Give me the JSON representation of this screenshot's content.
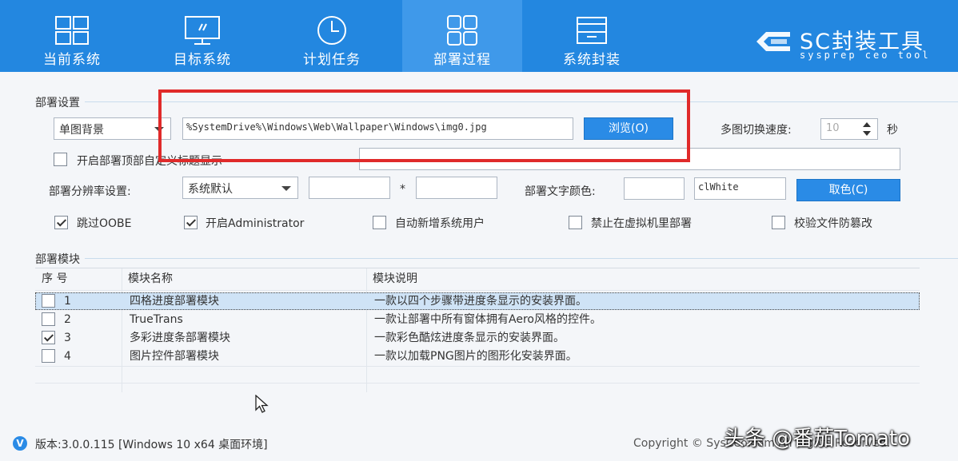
{
  "nav": {
    "tabs": [
      {
        "label": "当前系统",
        "icon": "windows-grid-icon"
      },
      {
        "label": "目标系统",
        "icon": "monitor-icon"
      },
      {
        "label": "计划任务",
        "icon": "clock-icon"
      },
      {
        "label": "部署过程",
        "icon": "blocks-icon",
        "active": true
      },
      {
        "label": "系统封装",
        "icon": "package-icon"
      }
    ],
    "brand_title": "SC封装工具",
    "brand_sub": "sysprep ceo tool"
  },
  "deploy_settings": {
    "title": "部署设置",
    "background_mode": "单图背景",
    "wallpaper_path": "%SystemDrive%\\Windows\\Web\\Wallpaper\\Windows\\img0.jpg",
    "browse_label": "浏览(O)",
    "switch_speed_label": "多图切换速度:",
    "switch_speed_value": "10",
    "seconds_label": "秒",
    "custom_title_checkbox_label": "开启部署顶部自定义标题显示",
    "custom_title_input_value": "",
    "resolution_label": "部署分辨率设置:",
    "resolution_mode": "系统默认",
    "resolution_width": "",
    "resolution_times": "*",
    "resolution_height": "",
    "text_color_label": "部署文字颜色:",
    "text_color_hex": "",
    "text_color_name": "clWhite",
    "pick_color_label": "取色(C)",
    "options": [
      {
        "label": "跳过OOBE",
        "checked": true
      },
      {
        "label": "开启Administrator",
        "checked": true
      },
      {
        "label": "自动新增系统用户",
        "checked": false
      },
      {
        "label": "禁止在虚拟机里部署",
        "checked": false
      },
      {
        "label": "校验文件防篡改",
        "checked": false
      }
    ]
  },
  "modules": {
    "title": "部署模块",
    "headers": {
      "no": "序 号",
      "name": "模块名称",
      "desc": "模块说明"
    },
    "rows": [
      {
        "no": "1",
        "name": "四格进度部署模块",
        "desc": "一款以四个步骤带进度条显示的安装界面。",
        "checked": false,
        "selected": true
      },
      {
        "no": "2",
        "name": "TrueTrans",
        "desc": "一款让部署中所有窗体拥有Aero风格的控件。",
        "checked": false,
        "selected": false
      },
      {
        "no": "3",
        "name": "多彩进度条部署模块",
        "desc": "一款彩色酷炫进度条显示的安装界面。",
        "checked": true,
        "selected": false
      },
      {
        "no": "4",
        "name": "图片控件部署模块",
        "desc": "一款以加载PNG图片的图形化安装界面。",
        "checked": false,
        "selected": false
      }
    ]
  },
  "status": {
    "version": "版本:3.0.0.115 [Windows 10 x64 桌面环境]",
    "copyright": "Copyright © SysCeo.com All Rights Reserved.",
    "watermark": "头条 @番茄Tomato"
  },
  "colors": {
    "accent": "#2387e0",
    "active_tab": "#3f99ea",
    "highlight": "#e02a2a",
    "selection": "#cfe3f6"
  }
}
